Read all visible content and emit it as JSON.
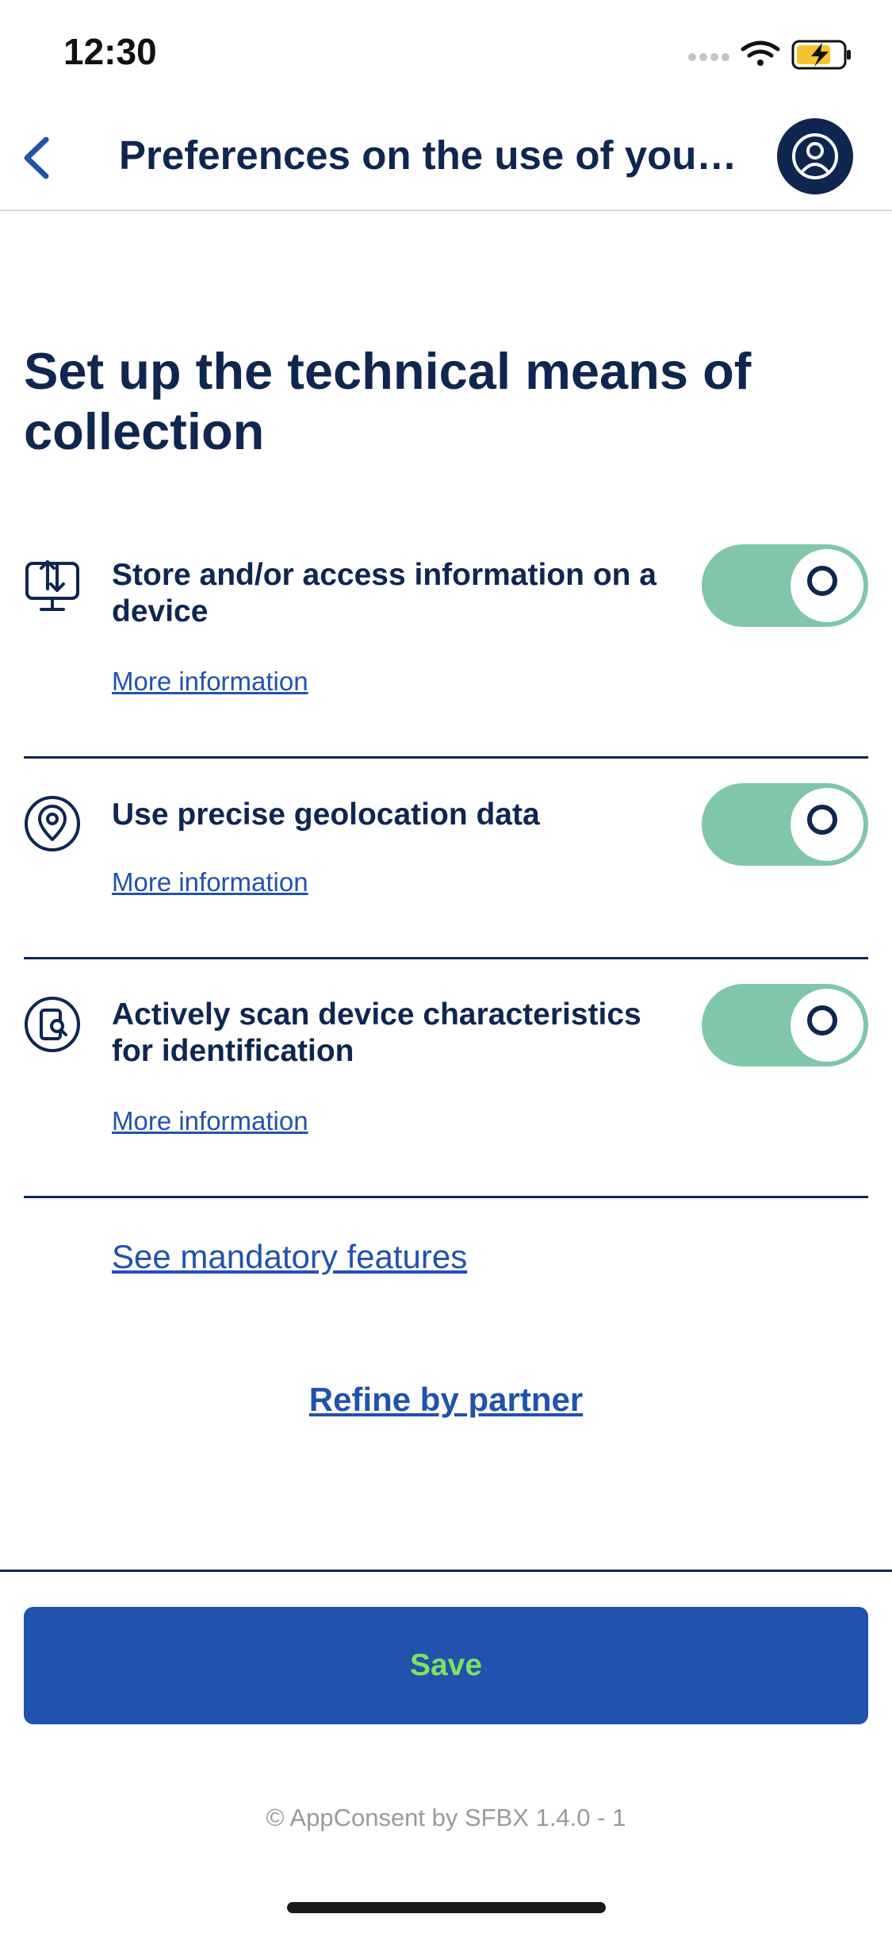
{
  "status_bar": {
    "time": "12:30",
    "icons": [
      "signal-dots-icon",
      "wifi-icon",
      "battery-charging-icon"
    ]
  },
  "nav": {
    "back_icon": "chevron-left-icon",
    "title": "Preferences on the use of your…",
    "avatar_icon": "user-circle-icon"
  },
  "heading": "Set up the technical means of collection",
  "options": [
    {
      "icon": "monitor-upload-icon",
      "title": "Store and/or access information on a device",
      "link": "More information",
      "enabled": true
    },
    {
      "icon": "location-pin-icon",
      "title": "Use precise geolocation data",
      "link": "More information",
      "enabled": true
    },
    {
      "icon": "device-scan-icon",
      "title": "Actively scan device characteristics for identification",
      "link": "More information",
      "enabled": true
    }
  ],
  "mandatory_link": "See mandatory features",
  "refine_link": "Refine by partner",
  "save_label": "Save",
  "copyright": "© AppConsent by SFBX 1.4.0 - 1",
  "colors": {
    "navy": "#0f2650",
    "link_blue": "#2152ad",
    "toggle_on": "#80c6ab",
    "save_text": "#7be35e"
  }
}
